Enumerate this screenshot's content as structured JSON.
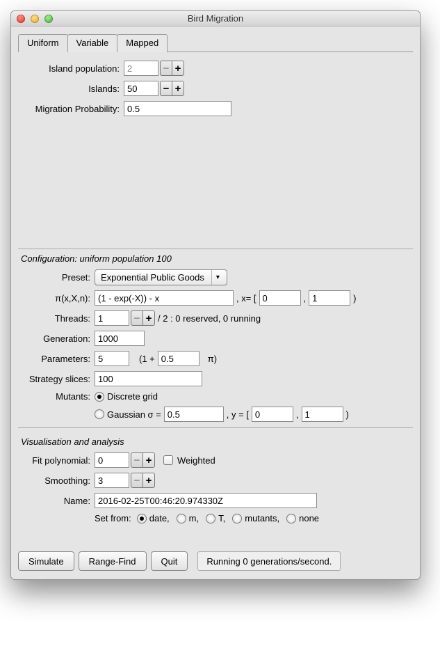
{
  "window": {
    "title": "Bird Migration"
  },
  "tabs": {
    "uniform": "Uniform",
    "variable": "Variable",
    "mapped": "Mapped",
    "active": "uniform"
  },
  "upper": {
    "island_population_label": "Island population:",
    "island_population_value": "2",
    "islands_label": "Islands:",
    "islands_value": "50",
    "migration_prob_label": "Migration Probability:",
    "migration_prob_value": "0.5"
  },
  "config": {
    "header": "Configuration: uniform population 100",
    "preset_label": "Preset:",
    "preset_value": "Exponential Public Goods",
    "pi_label": "π(x,X,n):",
    "pi_value": "(1 - exp(-X)) - x",
    "x_eq": ", x= [",
    "x_lo": "0",
    "x_comma": ",",
    "x_hi": "1",
    "x_close": ")",
    "threads_label": "Threads:",
    "threads_value": "1",
    "threads_info": " / 2 : 0 reserved, 0 running",
    "generation_label": "Generation:",
    "generation_value": "1000",
    "parameters_label": "Parameters:",
    "parameters_value": "5",
    "param_open": "(1 +",
    "param_second": "0.5",
    "param_close": "π)",
    "slices_label": "Strategy slices:",
    "slices_value": "100",
    "mutants_label": "Mutants:",
    "mutants_discrete": "Discrete grid",
    "mutants_gaussian": "Gaussian σ =",
    "gaussian_sigma": "0.5",
    "y_eq": ", y = [",
    "y_lo": "0",
    "y_comma": ",",
    "y_hi": "1",
    "y_close": ")"
  },
  "vis": {
    "header": "Visualisation and analysis",
    "fit_label": "Fit polynomial:",
    "fit_value": "0",
    "weighted_label": "Weighted",
    "smoothing_label": "Smoothing:",
    "smoothing_value": "3",
    "name_label": "Name:",
    "name_value": "2016-02-25T00:46:20.974330Z",
    "setfrom_label": "Set from:",
    "opt_date": "date,",
    "opt_m": "m,",
    "opt_T": "T,",
    "opt_mutants": "mutants,",
    "opt_none": "none"
  },
  "buttons": {
    "simulate": "Simulate",
    "rangefind": "Range-Find",
    "quit": "Quit",
    "status": "Running 0 generations/second."
  },
  "glyphs": {
    "minus": "−",
    "plus": "+",
    "darrow": "▾"
  }
}
